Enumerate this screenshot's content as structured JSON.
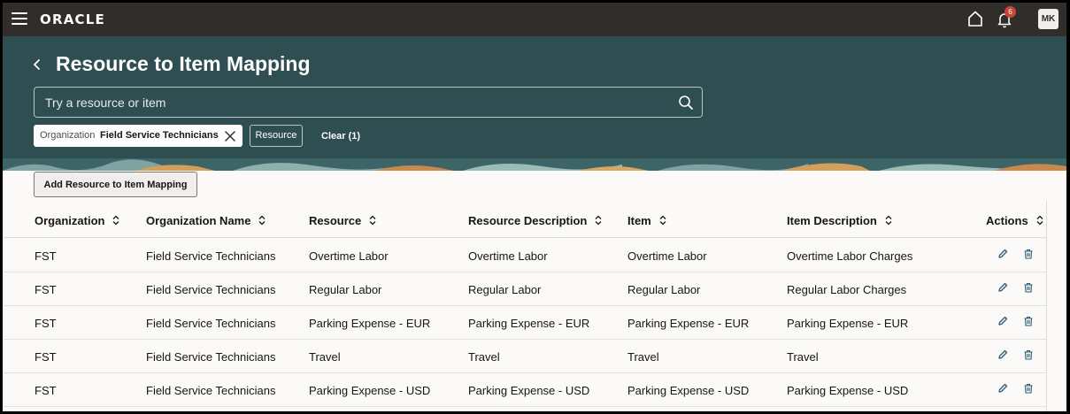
{
  "topbar": {
    "brand": "ORACLE",
    "notification_count": "6",
    "avatar_initials": "MK"
  },
  "header": {
    "title": "Resource to Item Mapping",
    "search_placeholder": "Try a resource or item",
    "filter_chip": {
      "key": "Organization",
      "value": "Field Service Technicians"
    },
    "resource_chip": "Resource",
    "clear_label": "Clear (1)"
  },
  "toolbar": {
    "add_label": "Add Resource to Item Mapping"
  },
  "table": {
    "columns": [
      "Organization",
      "Organization Name",
      "Resource",
      "Resource Description",
      "Item",
      "Item Description",
      "Actions"
    ],
    "rows": [
      [
        "FST",
        "Field Service Technicians",
        "Overtime Labor",
        "Overtime Labor",
        "Overtime Labor",
        "Overtime Labor Charges"
      ],
      [
        "FST",
        "Field Service Technicians",
        "Regular Labor",
        "Regular Labor",
        "Regular Labor",
        "Regular Labor Charges"
      ],
      [
        "FST",
        "Field Service Technicians",
        "Parking Expense - EUR",
        "Parking Expense - EUR",
        "Parking Expense - EUR",
        "Parking Expense - EUR"
      ],
      [
        "FST",
        "Field Service Technicians",
        "Travel",
        "Travel",
        "Travel",
        "Travel"
      ],
      [
        "FST",
        "Field Service Technicians",
        "Parking Expense - USD",
        "Parking Expense - USD",
        "Parking Expense - USD",
        "Parking Expense - USD"
      ]
    ]
  },
  "colors": {
    "topbar": "#312d2a",
    "banner": "#2e4e51",
    "accent": "#2a5b75",
    "badge": "#c74634"
  },
  "icons": [
    "hamburger-icon",
    "home-icon",
    "bell-icon",
    "back-icon",
    "search-icon",
    "close-icon",
    "sort-icon",
    "edit-icon",
    "delete-icon"
  ]
}
